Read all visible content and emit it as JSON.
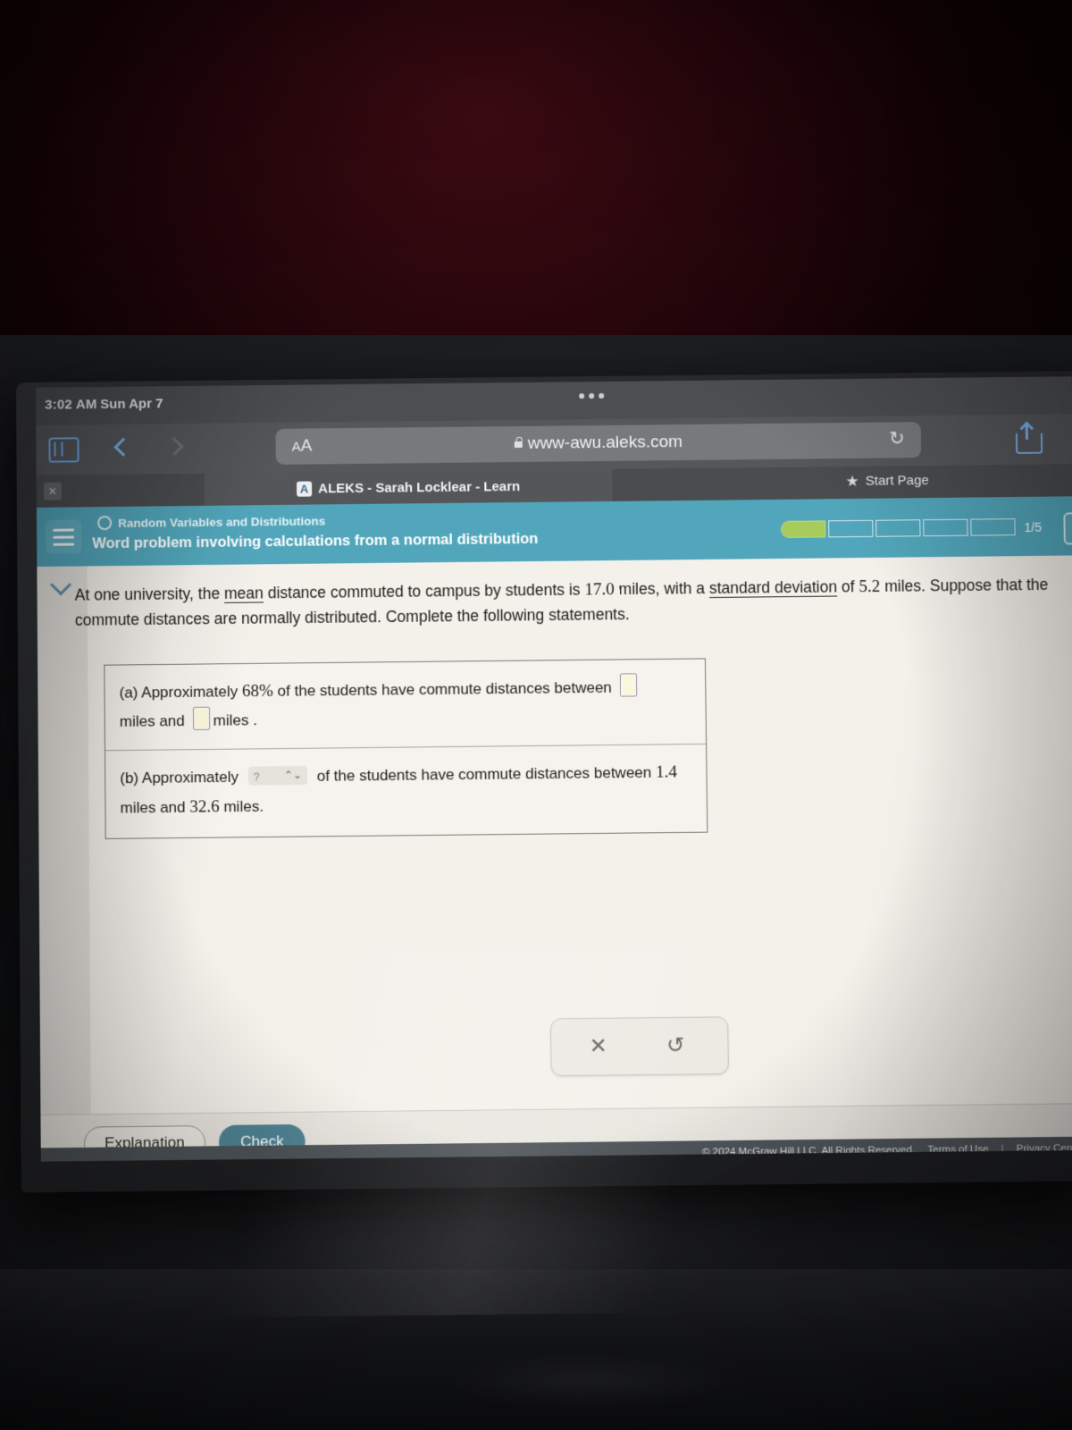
{
  "status_bar": {
    "time": "3:02 AM",
    "date": "Sun Apr 7",
    "dots_icon": "more-dots-icon"
  },
  "browser": {
    "sidebar_icon": "sidebar-toggle-icon",
    "back_icon": "chevron-left-icon",
    "forward_icon": "chevron-right-icon",
    "text_size_label": "AA",
    "lock_icon": "lock-icon",
    "url": "www-awu.aleks.com",
    "reload_icon": "↻",
    "share_icon": "share-icon",
    "tab": {
      "close_label": "✕",
      "favicon_letter": "A",
      "title": "ALEKS - Sarah Locklear - Learn"
    },
    "bookmark": {
      "star_icon": "★",
      "label": "Start Page"
    }
  },
  "aleks_header": {
    "menu_icon": "hamburger-menu-icon",
    "topic_circle_icon": "topic-status-circle-icon",
    "topic": "Random Variables and Distributions",
    "lesson_title": "Word problem involving calculations from a normal distribution",
    "progress": {
      "total_segments": 5,
      "completed_segments": 1,
      "label": "1/5",
      "fill_color": "#a8cc5c"
    },
    "accent_color": "#52a6bb"
  },
  "rail": {
    "collapse_icon": "chevron-down-icon"
  },
  "problem": {
    "intro_part1": "At one university, the ",
    "term_mean": "mean",
    "intro_part2": " distance commuted to campus by students is ",
    "mean_value": "17.0",
    "intro_part3": " miles, with a ",
    "term_sd": "standard deviation",
    "intro_part4": " of ",
    "sd_value": "5.2",
    "intro_part5": " miles. Suppose that the commute distances are normally distributed. Complete the following statements.",
    "part_a": {
      "label": "(a) Approximately ",
      "percent": "68%",
      "text_mid": " of the students have commute distances between ",
      "blank1_value": "",
      "unit1": "miles",
      "and_word": "and",
      "blank2_value": "",
      "unit2": "miles ."
    },
    "part_b": {
      "label": "(b) Approximately ",
      "dropdown": {
        "selected": "?",
        "caret_icon": "select-caret-icon"
      },
      "text_mid": " of the students have commute distances between ",
      "low_value": "1.4",
      "text_mid2": " miles and ",
      "high_value": "32.6",
      "unit": " miles."
    }
  },
  "toolbar": {
    "clear_icon": "✕",
    "clear_name": "clear-answer-button",
    "undo_icon": "↺",
    "undo_name": "undo-button"
  },
  "actions": {
    "explanation_label": "Explanation",
    "check_label": "Check",
    "check_color": "#4f8494"
  },
  "footer": {
    "copyright": "© 2024 McGraw Hill LLC. All Rights Reserved.",
    "terms_label": "Terms of Use",
    "separator": "|",
    "privacy_label": "Privacy Center"
  }
}
